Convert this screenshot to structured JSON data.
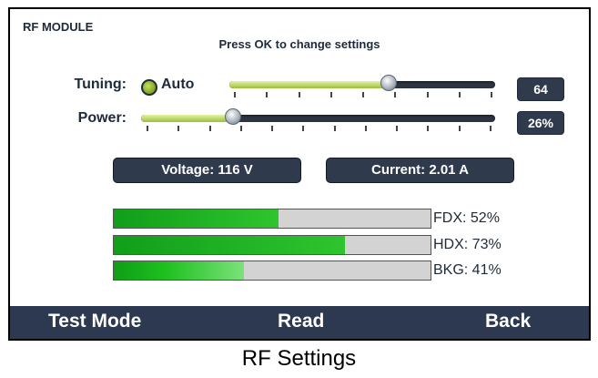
{
  "screen": {
    "module_title": "RF MODULE",
    "hint": "Press OK to change settings"
  },
  "tuning": {
    "label": "Tuning:",
    "mode_label": "Auto",
    "mode_selected": true,
    "value": "64",
    "level": 0.6
  },
  "power": {
    "label": "Power:",
    "value": "26%",
    "level": 0.26
  },
  "readouts": {
    "voltage": "Voltage: 116 V",
    "current": "Current: 2.01 A"
  },
  "meters": [
    {
      "label": "FDX: 52%",
      "percent": 52
    },
    {
      "label": "HDX: 73%",
      "percent": 73
    },
    {
      "label": "BKG: 41%",
      "percent": 41
    }
  ],
  "soft_keys": {
    "left": "Test Mode",
    "center": "Read",
    "right": "Back"
  },
  "caption": "RF Settings",
  "colors": {
    "panel": "#2f3a4d",
    "meter_fill": "#1fc01f",
    "slider_fill": "#9abf3a"
  }
}
